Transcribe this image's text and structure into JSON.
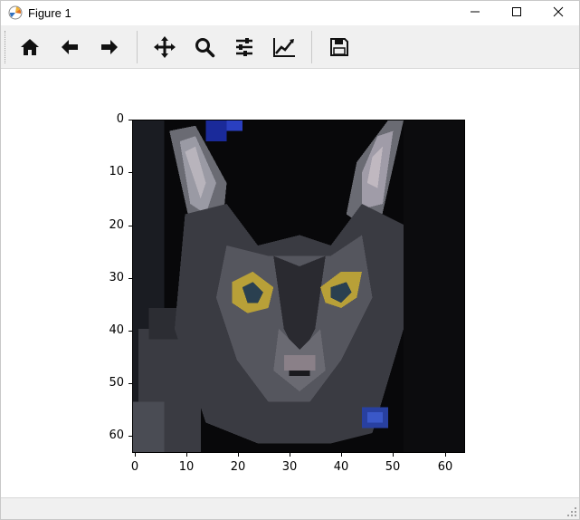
{
  "window": {
    "title": "Figure 1",
    "controls": [
      "minimize-icon",
      "maximize-icon",
      "close-icon"
    ]
  },
  "toolbar": {
    "buttons": [
      {
        "name": "home",
        "icon": "home-icon"
      },
      {
        "name": "back",
        "icon": "arrow-left-icon"
      },
      {
        "name": "forward",
        "icon": "arrow-right-icon"
      },
      {
        "name": "pan",
        "icon": "move-icon"
      },
      {
        "name": "zoom",
        "icon": "magnifier-icon"
      },
      {
        "name": "subplots",
        "icon": "sliders-icon"
      },
      {
        "name": "edit-axes",
        "icon": "line-chart-icon"
      },
      {
        "name": "save",
        "icon": "floppy-disk-icon"
      }
    ]
  },
  "figure": {
    "image_subject": "cat",
    "y_ticks": [
      "0",
      "10",
      "20",
      "30",
      "40",
      "50",
      "60"
    ],
    "x_ticks": [
      "0",
      "10",
      "20",
      "30",
      "40",
      "50",
      "60"
    ]
  },
  "statusbar": {
    "message": ""
  }
}
